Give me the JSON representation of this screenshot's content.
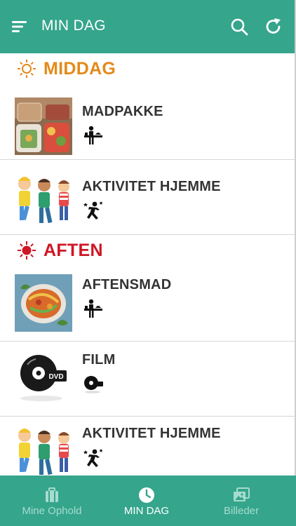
{
  "header": {
    "title": "MIN DAG",
    "menu_icon": "menu-icon",
    "search_icon": "search-icon",
    "refresh_icon": "refresh-icon"
  },
  "sections": [
    {
      "title": "MIDDAG",
      "icon": "sun-outline-icon",
      "color": "#e38a1a",
      "items": [
        {
          "title": "MADPAKKE",
          "thumb": "lunchbox-photo",
          "category_icon": "food-icon"
        },
        {
          "title": "AKTIVITET HJEMME",
          "thumb": "kids-cartoon",
          "category_icon": "activity-icon"
        }
      ]
    },
    {
      "title": "AFTEN",
      "icon": "sun-filled-icon",
      "color": "#cf1624",
      "items": [
        {
          "title": "AFTENSMAD",
          "thumb": "dinner-photo",
          "category_icon": "food-icon"
        },
        {
          "title": "FILM",
          "thumb": "dvd-image",
          "category_icon": "dvd-icon"
        },
        {
          "title": "AKTIVITET HJEMME",
          "thumb": "kids-cartoon",
          "category_icon": "activity-icon"
        }
      ]
    }
  ],
  "bottom_nav": [
    {
      "label": "Mine Ophold",
      "icon": "suitcase-icon",
      "active": false
    },
    {
      "label": "MIN DAG",
      "icon": "clock-icon",
      "active": true
    },
    {
      "label": "Billeder",
      "icon": "images-icon",
      "active": false
    }
  ],
  "colors": {
    "primary": "#35a58c",
    "middag": "#e38a1a",
    "aften": "#cf1624",
    "nav_inactive": "#a6dccf"
  }
}
